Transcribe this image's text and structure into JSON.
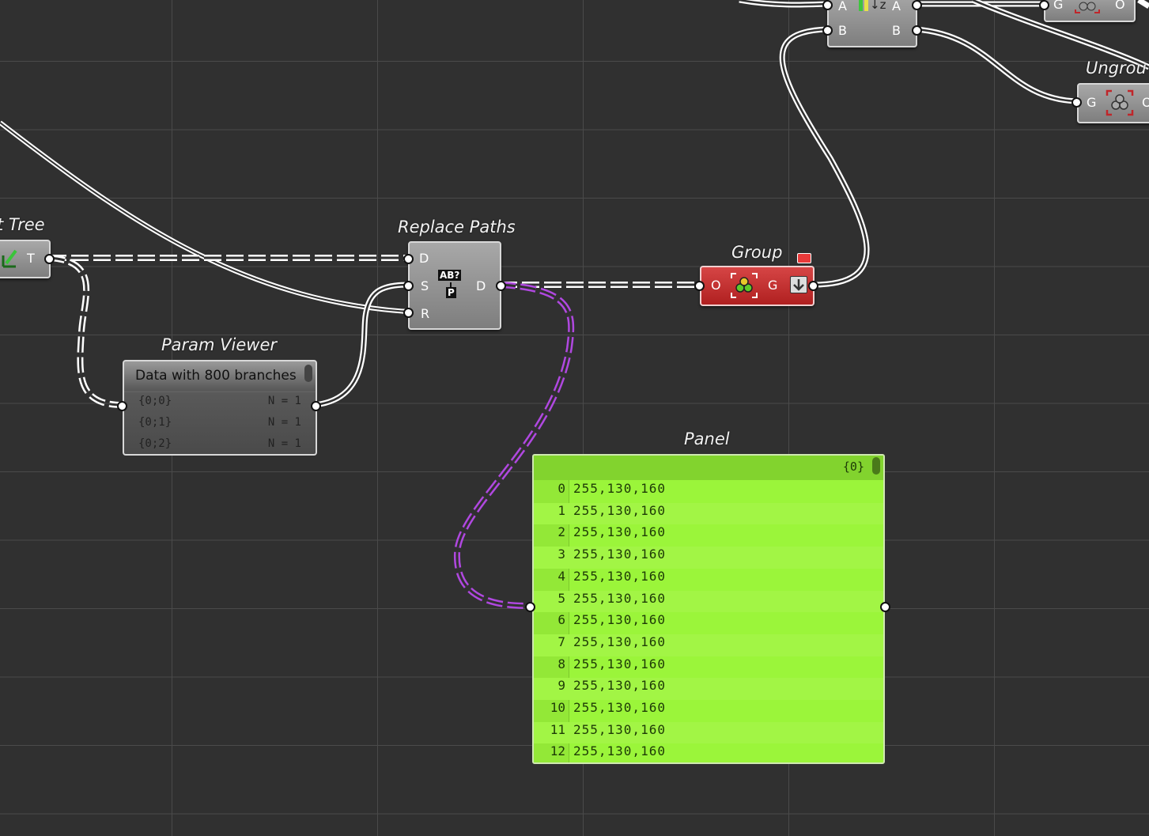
{
  "components": {
    "tree_fragment": {
      "label": "t Tree",
      "port_out": "T"
    },
    "replace_paths": {
      "label": "Replace Paths",
      "inputs": [
        "D",
        "S",
        "R"
      ],
      "output": "D",
      "icon": "replace-paths-icon",
      "icon_text_top": "AB?",
      "icon_text_bottom": "P"
    },
    "group": {
      "label": "Group",
      "input": "O",
      "output": "G",
      "icon": "group-icon"
    },
    "sort": {
      "inputs": [
        "A",
        "B"
      ],
      "outputs": [
        "A",
        "B"
      ],
      "icon": "sort-icon",
      "icon_text": "↓z"
    },
    "ungroup": {
      "label": "Ungrou",
      "input": "G",
      "output": "O",
      "icon": "ungroup-icon"
    },
    "top_right": {
      "input": "G",
      "output": "O"
    }
  },
  "param_viewer": {
    "label": "Param Viewer",
    "header": "Data with 800 branches",
    "rows": [
      {
        "path": "{0;0}",
        "count": "N = 1"
      },
      {
        "path": "{0;1}",
        "count": "N = 1"
      },
      {
        "path": "{0;2}",
        "count": "N = 1"
      }
    ]
  },
  "panel": {
    "label": "Panel",
    "branch": "{0}",
    "rows": [
      {
        "index": "0",
        "value": "255,130,160"
      },
      {
        "index": "1",
        "value": "255,130,160"
      },
      {
        "index": "2",
        "value": "255,130,160"
      },
      {
        "index": "3",
        "value": "255,130,160"
      },
      {
        "index": "4",
        "value": "255,130,160"
      },
      {
        "index": "5",
        "value": "255,130,160"
      },
      {
        "index": "6",
        "value": "255,130,160"
      },
      {
        "index": "7",
        "value": "255,130,160"
      },
      {
        "index": "8",
        "value": "255,130,160"
      },
      {
        "index": "9",
        "value": "255,130,160"
      },
      {
        "index": "10",
        "value": "255,130,160"
      },
      {
        "index": "11",
        "value": "255,130,160"
      },
      {
        "index": "12",
        "value": "255,130,160"
      }
    ]
  },
  "colors": {
    "canvas": "#303030",
    "grid": "#4a4a4a",
    "wire": "#ffffff",
    "selected_wire": "#a040c8",
    "panel": "#9bf53a",
    "group_component": "#c83030"
  }
}
